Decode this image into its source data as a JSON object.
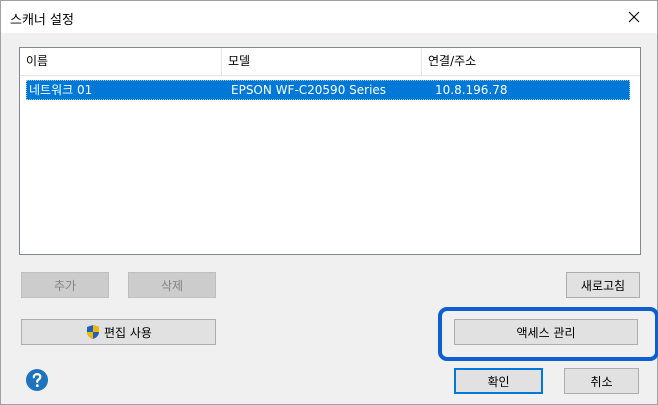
{
  "window": {
    "title": "스캐너 설정",
    "close_glyph": "✕"
  },
  "list": {
    "columns": [
      "이름",
      "모델",
      "연결/주소"
    ],
    "rows": [
      {
        "name": "네트워크 01",
        "model": "EPSON WF-C20590 Series",
        "address": "10.8.196.78",
        "selected": true
      }
    ]
  },
  "buttons": {
    "add": "추가",
    "delete": "삭제",
    "refresh": "새로고침",
    "enable_edit": "편집 사용",
    "access_management": "액세스 관리",
    "ok": "확인",
    "cancel": "취소"
  },
  "icons": {
    "help": "help-icon",
    "shield": "uac-shield-icon"
  },
  "colors": {
    "selection": "#0078d7",
    "highlight_frame": "#0d5fd1",
    "help_icon": "#1e73be"
  }
}
